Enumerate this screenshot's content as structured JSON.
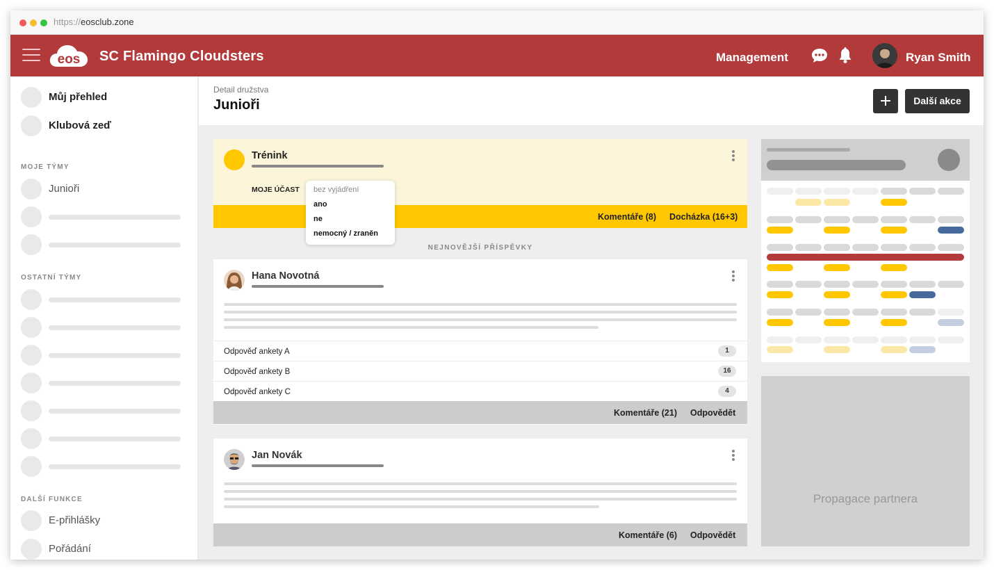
{
  "browser": {
    "url_protocol": "https://",
    "url_host": "eosclub.zone"
  },
  "topbar": {
    "logo_text": "eos",
    "club_name": "SC Flamingo Cloudsters",
    "management_label": "Management",
    "user_name": "Ryan Smith",
    "accent_color": "#b23a3b"
  },
  "sidebar": {
    "main_items": [
      {
        "label": "Můj přehled"
      },
      {
        "label": "Klubová zeď"
      }
    ],
    "my_teams_heading": "MOJE TÝMY",
    "my_teams": [
      {
        "label": "Junioři"
      }
    ],
    "other_teams_heading": "OSTATNÍ TÝMY",
    "more_heading": "DALŠÍ FUNKCE",
    "more_items": [
      {
        "label": "E-přihlášky"
      },
      {
        "label": "Pořádání"
      }
    ]
  },
  "page": {
    "breadcrumb": "Detail družstva",
    "title": "Junioři",
    "more_actions_label": "Další akce"
  },
  "event_card": {
    "title": "Trénink",
    "participation_label": "MOJE ÚČAST",
    "dropdown_options": [
      "bez vyjádření",
      "ano",
      "ne",
      "nemocný / zraněn"
    ],
    "comments_label": "Komentáře (8)",
    "attendance_label": "Docházka (16+3)",
    "highlight_color": "#ffc700"
  },
  "feed": {
    "section_label": "NEJNOVĚJŠÍ PŘÍSPĚVKY",
    "posts": [
      {
        "author": "Hana Novotná",
        "poll": [
          {
            "label": "Odpověď ankety A",
            "count": "1"
          },
          {
            "label": "Odpověď ankety B",
            "count": "16"
          },
          {
            "label": "Odpověď ankety C",
            "count": "4"
          }
        ],
        "comments_label": "Komentáře (21)",
        "reply_label": "Odpovědět"
      },
      {
        "author": "Jan Novák",
        "comments_label": "Komentáře (6)",
        "reply_label": "Odpovědět"
      }
    ]
  },
  "right_panel": {
    "calendar_colors": {
      "event": "#ffc700",
      "event_light": "#fbe8a6",
      "blue": "#46699b",
      "blue_light": "#c3cfe0",
      "red": "#b23a3b",
      "gray": "#d9d9d9",
      "gray_light": "#efefef"
    },
    "promo_label": "Propagace partnera"
  }
}
